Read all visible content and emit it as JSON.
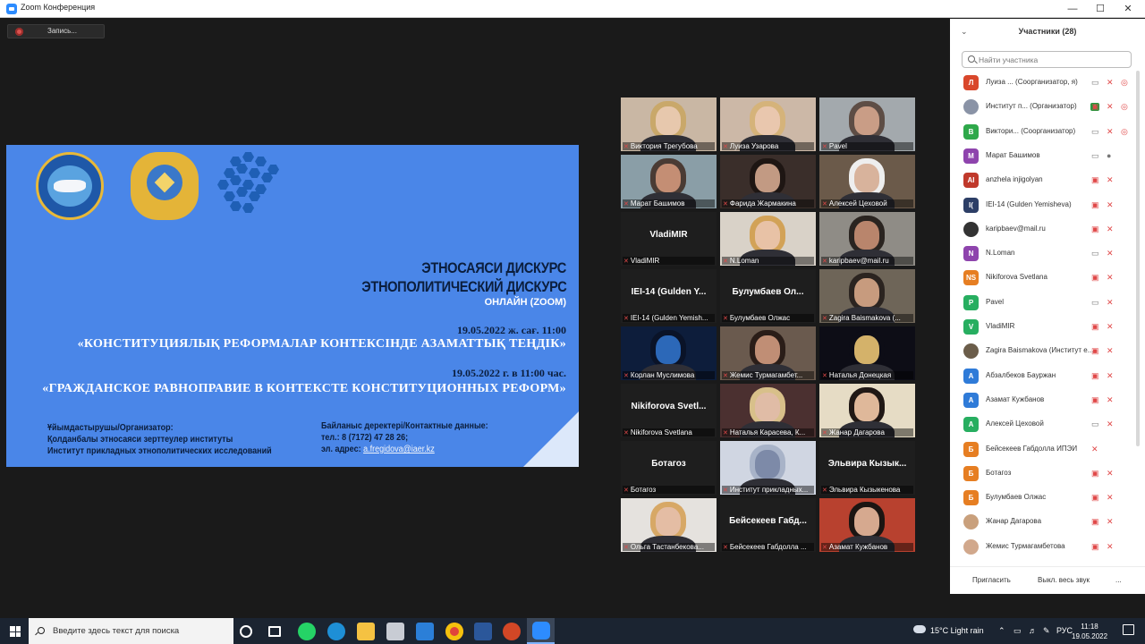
{
  "window": {
    "title": "Zoom Конференция"
  },
  "stage": {
    "recording_label": "Запись..."
  },
  "slide": {
    "line1": "ЭТНОСАЯСИ ДИСКУРС",
    "line2": "ЭТНОПОЛИТИЧЕСКИЙ ДИСКУРС",
    "line3": "ОНЛАЙН (ZOOM)",
    "date_kz": "19.05.2022 ж. сағ. 11:00",
    "heading_kz": "«КОНСТИТУЦИЯЛЫҚ РЕФОРМАЛАР КОНТЕКСІНДЕ АЗАМАТТЫҚ ТЕҢДІК»",
    "date_ru": "19.05.2022 г. в 11:00 час.",
    "heading_ru": "«ГРАЖДАНСКОЕ РАВНОПРАВИЕ В КОНТЕКСТЕ КОНСТИТУЦИОННЫХ РЕФОРМ»",
    "org_label": "Ұйымдастырушы/Организатор:",
    "org_kz": "Қолданбалы этносаяси зерттеулер институты",
    "org_ru": "Институт прикладных этнополитических исследований",
    "contact_label": "Байланыс деректері/Контактные данные:",
    "contact_phone": "тел.: 8 (7172) 47 28 26;",
    "contact_email_label": "эл. адрес:",
    "contact_email": "a.fregidova@iaer.kz"
  },
  "tiles": [
    {
      "name": "Виктория Трегубова",
      "type": "photo",
      "bg": "#c9b7a4",
      "face": "#e7c8ad",
      "hair": "#c9a86a"
    },
    {
      "name": "Луиза Узарова",
      "type": "photo",
      "bg": "#ccb8a7",
      "face": "#e9c7ae",
      "hair": "#d5b37a"
    },
    {
      "name": "Pavel",
      "type": "photo",
      "bg": "#a3a9ad",
      "face": "#c99d86",
      "hair": "#5d4d45"
    },
    {
      "name": "Марат Башимов",
      "type": "photo",
      "active": true,
      "bg": "#8a9ea7",
      "face": "#c48e74",
      "hair": "#4a3b34"
    },
    {
      "name": "Фарида Жармакина",
      "type": "photo",
      "bg": "#3a2e2a",
      "face": "#c29a83",
      "hair": "#1e1613"
    },
    {
      "name": "Алексей Цеховой",
      "type": "photo",
      "bg": "#6b5a4a",
      "face": "#d8b39c",
      "hair": "#eeeeee"
    },
    {
      "name": "VladiMIR",
      "type": "text",
      "label": "VladiMIR"
    },
    {
      "name": "N.Loman",
      "type": "photo",
      "bg": "#d9d2c8",
      "face": "#e8c2a6",
      "hair": "#d2a257"
    },
    {
      "name": "karipbaev@mail.ru",
      "type": "photo",
      "bg": "#8f8c86",
      "face": "#b9856c",
      "hair": "#2a2420"
    },
    {
      "name": "IEI-14 (Gulden Yemish...",
      "type": "text",
      "label": "IEI-14 (Gulden Y..."
    },
    {
      "name": "Булумбаев Олжас",
      "type": "text",
      "label": "Булумбаев Ол..."
    },
    {
      "name": "Zagira Baismakova (...",
      "type": "photo",
      "bg": "#6e6558",
      "face": "#c79b7e",
      "hair": "#2b2420"
    },
    {
      "name": "Корлан Муслимова",
      "type": "photo",
      "bg": "#0d1d3b",
      "face": "#2c68b8",
      "hair": "#0a1328"
    },
    {
      "name": "Жемис Турмагамбет...",
      "type": "photo",
      "bg": "#6a5a4e",
      "face": "#c08e75",
      "hair": "#2a1d18"
    },
    {
      "name": "Наталья Донецкая",
      "type": "photo",
      "bg": "#0d0d16",
      "face": "#d4b26a",
      "hair": "#0d0d16"
    },
    {
      "name": "Nikiforova Svetlana",
      "type": "text",
      "label": "Nikiforova Svetl..."
    },
    {
      "name": "Наталья Карасева, К...",
      "type": "photo",
      "bg": "#4b3030",
      "face": "#e0bca6",
      "hair": "#d8c08a"
    },
    {
      "name": "Жанар Дагарова",
      "type": "photo",
      "bg": "#e6dcc5",
      "face": "#dfb89a",
      "hair": "#201815"
    },
    {
      "name": "Ботагоз",
      "type": "text",
      "label": "Ботагоз"
    },
    {
      "name": "Институт прикладных...",
      "type": "photo",
      "bg": "#d0d6e2",
      "face": "#7d8aa8",
      "hair": "#a8b3c8"
    },
    {
      "name": "Эльвира Кызыкенова",
      "type": "text",
      "label": "Эльвира Кызык..."
    },
    {
      "name": "Ольга Тастанбекова...",
      "type": "photo",
      "bg": "#e5e2de",
      "face": "#e4bda4",
      "hair": "#d7a866"
    },
    {
      "name": "Бейсекеев Габдолла ...",
      "type": "text",
      "label": "Бейсекеев Габд..."
    },
    {
      "name": "Азамат Кужбанов",
      "type": "photo",
      "bg": "#b8412f",
      "face": "#d6a98f",
      "hair": "#1b1512"
    }
  ],
  "panel": {
    "title": "Участники (28)",
    "search_placeholder": "Найти участника",
    "invite_label": "Пригласить",
    "mute_all_label": "Выкл. весь звук",
    "more_label": "...",
    "participants": [
      {
        "initials": "Л",
        "color": "#d9472b",
        "name": "Луиза ... (Соорганизатор, я)",
        "icons": [
          "rec",
          "mic-muted",
          "cam-on"
        ]
      },
      {
        "initials": "",
        "color": "#8a93a6",
        "name": "Институт п... (Организатор)",
        "icons": [
          "badge",
          "rec",
          "mic-muted",
          "cam-muted"
        ],
        "logo": true
      },
      {
        "initials": "В",
        "color": "#2ea84a",
        "name": "Виктори... (Соорганизатор)",
        "icons": [
          "rec",
          "mic-muted",
          "cam-on"
        ]
      },
      {
        "initials": "М",
        "color": "#8e44ad",
        "name": "Марат Башимов",
        "icons": [
          "mic-on",
          "cam-on"
        ]
      },
      {
        "initials": "AI",
        "color": "#c0392b",
        "name": "anzhela injigolyan",
        "icons": [
          "mic-muted",
          "cam-muted"
        ]
      },
      {
        "initials": "I(",
        "color": "#2c3e66",
        "name": "IEI-14 (Gulden Yemisheva)",
        "icons": [
          "mic-muted",
          "cam-muted"
        ]
      },
      {
        "initials": "",
        "color": "#333333",
        "name": "karipbaev@mail.ru",
        "icons": [
          "mic-muted",
          "cam-muted"
        ],
        "photo": true
      },
      {
        "initials": "N",
        "color": "#8e44ad",
        "name": "N.Loman",
        "icons": [
          "mic-muted",
          "cam-on"
        ]
      },
      {
        "initials": "NS",
        "color": "#e67e22",
        "name": "Nikiforova Svetlana",
        "icons": [
          "mic-muted",
          "cam-muted"
        ]
      },
      {
        "initials": "P",
        "color": "#27ae60",
        "name": "Pavel",
        "icons": [
          "mic-muted",
          "cam-on"
        ]
      },
      {
        "initials": "V",
        "color": "#27ae60",
        "name": "VladiMIR",
        "icons": [
          "mic-muted",
          "cam-muted"
        ]
      },
      {
        "initials": "",
        "color": "#6b5d4a",
        "name": "Zagira Baismakova (Институт е...",
        "icons": [
          "mic-muted",
          "cam-muted"
        ],
        "photo": true
      },
      {
        "initials": "А",
        "color": "#2f7bd8",
        "name": "Абзалбеков Бауржан",
        "icons": [
          "mic-muted",
          "cam-muted"
        ]
      },
      {
        "initials": "А",
        "color": "#2f7bd8",
        "name": "Азамат Кужбанов",
        "icons": [
          "mic-muted",
          "cam-muted"
        ]
      },
      {
        "initials": "А",
        "color": "#27ae60",
        "name": "Алексей Цеховой",
        "icons": [
          "mic-muted",
          "cam-on"
        ]
      },
      {
        "initials": "Б",
        "color": "#e67e22",
        "name": "Бейсекеев Габдолла ИПЭИ",
        "icons": [
          "mic-muted"
        ]
      },
      {
        "initials": "Б",
        "color": "#e67e22",
        "name": "Ботагоз",
        "icons": [
          "mic-muted",
          "cam-muted"
        ]
      },
      {
        "initials": "Б",
        "color": "#e67e22",
        "name": "Булумбаев Олжас",
        "icons": [
          "mic-muted",
          "cam-muted"
        ]
      },
      {
        "initials": "",
        "color": "#c9a07c",
        "name": "Жанар Дагарова",
        "icons": [
          "mic-muted",
          "cam-muted"
        ],
        "photo": true
      },
      {
        "initials": "",
        "color": "#d1a88c",
        "name": "Жемис Турмагамбетова",
        "icons": [
          "mic-muted",
          "cam-muted"
        ],
        "photo": true
      }
    ]
  },
  "taskbar": {
    "search_placeholder": "Введите здесь текст для поиска",
    "weather": "15°C  Light rain",
    "lang": "РУС",
    "time": "11:18",
    "date": "19.05.2022"
  }
}
